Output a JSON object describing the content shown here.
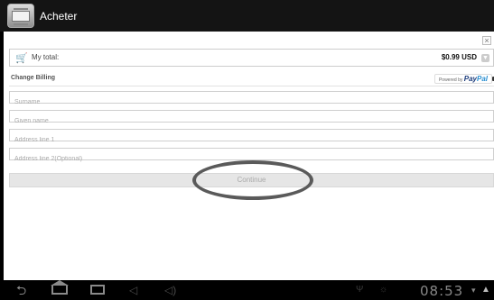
{
  "header": {
    "title": "Acheter",
    "icon": "credit-card-icon"
  },
  "dialog": {
    "close_label": "×"
  },
  "total": {
    "label": "My total:",
    "amount": "$0.99 USD",
    "icon": "cart-icon",
    "expand_icon": "chevron-down-icon"
  },
  "billing": {
    "label": "Change Billing",
    "powered_by": "Powered by",
    "paypal_1": "Pay",
    "paypal_2": "Pal",
    "lock_icon": "lock-icon"
  },
  "form": {
    "surname_placeholder": "Surname",
    "given_name_placeholder": "Given name",
    "address1_placeholder": "Address line 1",
    "address2_placeholder": "Address line 2(Optional)",
    "continue_label": "Continue"
  },
  "status": {
    "time": "08:53"
  }
}
